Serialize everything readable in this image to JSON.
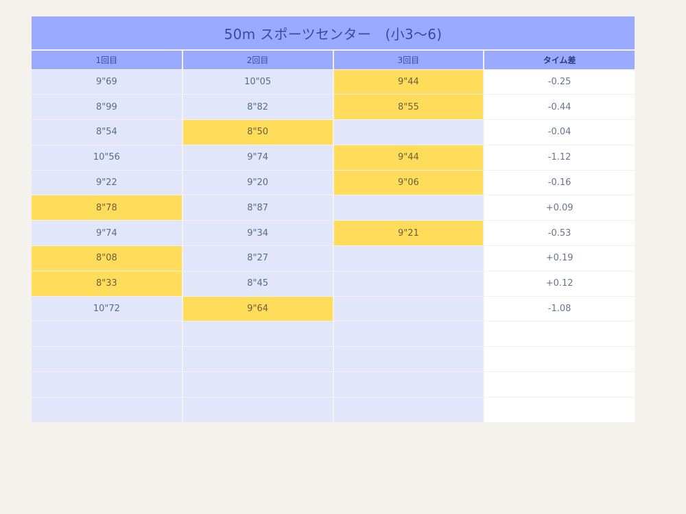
{
  "title": "50m スポーツセンター　(小3〜6)",
  "columns": [
    "1回目",
    "2回目",
    "3回目",
    "タイム差"
  ],
  "rows": [
    {
      "cells": [
        "9\"69",
        "10\"05",
        "9\"44",
        "-0.25"
      ],
      "best": 2
    },
    {
      "cells": [
        "8\"99",
        "8\"82",
        "8\"55",
        "-0.44"
      ],
      "best": 2
    },
    {
      "cells": [
        "8\"54",
        "8\"50",
        "",
        "-0.04"
      ],
      "best": 1
    },
    {
      "cells": [
        "10\"56",
        "9\"74",
        "9\"44",
        "-1.12"
      ],
      "best": 2
    },
    {
      "cells": [
        "9\"22",
        "9\"20",
        "9\"06",
        "-0.16"
      ],
      "best": 2
    },
    {
      "cells": [
        "8\"78",
        "8\"87",
        "",
        "+0.09"
      ],
      "best": 0
    },
    {
      "cells": [
        "9\"74",
        "9\"34",
        "9\"21",
        "-0.53"
      ],
      "best": 2
    },
    {
      "cells": [
        "8\"08",
        "8\"27",
        "",
        "+0.19"
      ],
      "best": 0
    },
    {
      "cells": [
        "8\"33",
        "8\"45",
        "",
        "+0.12"
      ],
      "best": 0
    },
    {
      "cells": [
        "10\"72",
        "9\"64",
        "",
        "-1.08"
      ],
      "best": 1
    },
    {
      "cells": [
        "",
        "",
        "",
        ""
      ],
      "best": -1
    },
    {
      "cells": [
        "",
        "",
        "",
        ""
      ],
      "best": -1
    },
    {
      "cells": [
        "",
        "",
        "",
        ""
      ],
      "best": -1
    },
    {
      "cells": [
        "",
        "",
        "",
        ""
      ],
      "best": -1
    }
  ],
  "colors": {
    "header": "#9aabff",
    "cell": "#e1e6fb",
    "best": "#ffdc5a",
    "diff": "#ffffff"
  }
}
